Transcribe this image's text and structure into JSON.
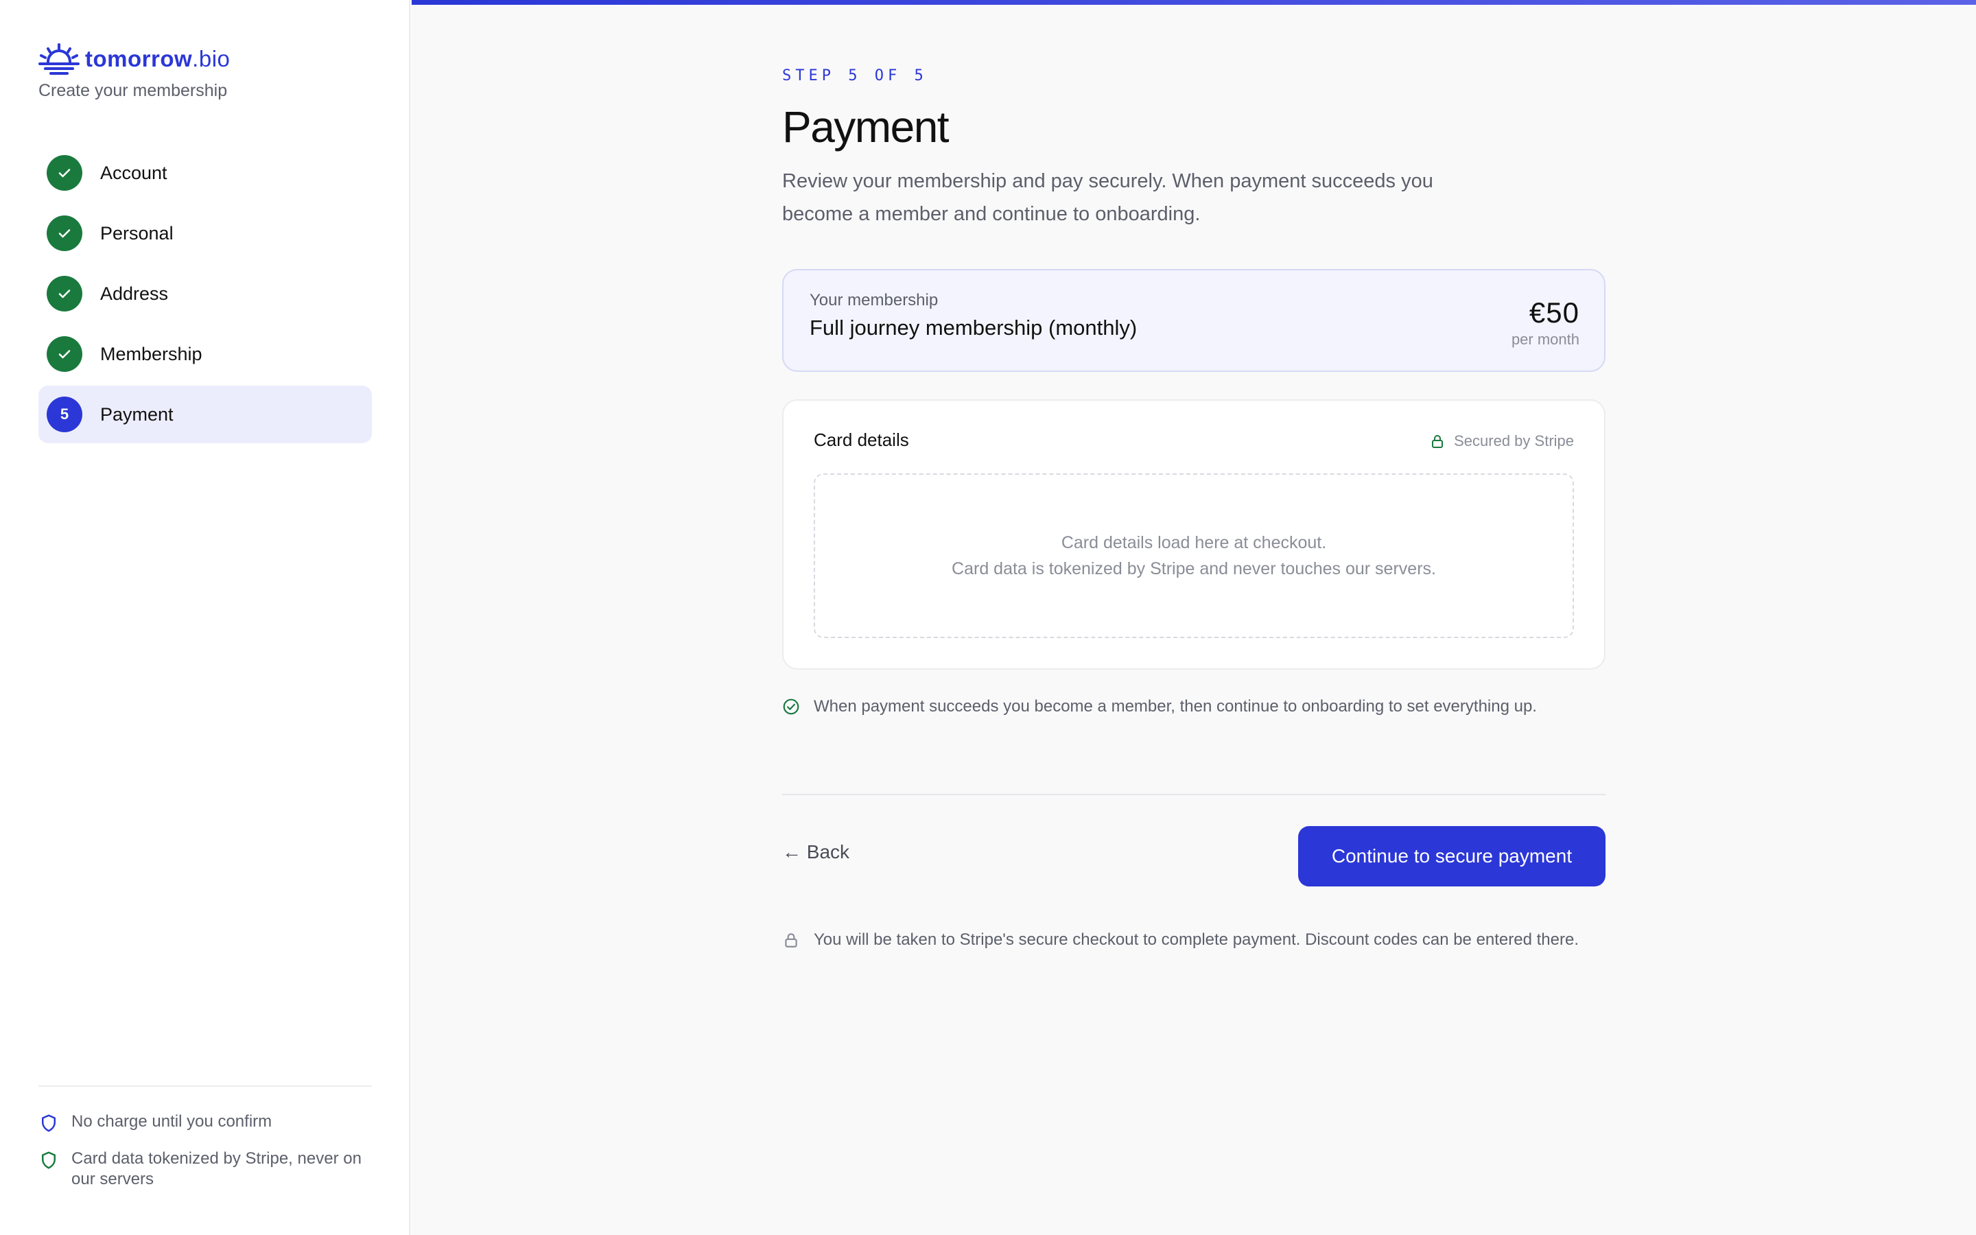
{
  "brand": {
    "name_bold": "tomorrow",
    "name_light": ".bio",
    "subtitle": "Create your membership",
    "color": "#2b37d6"
  },
  "steps": [
    {
      "label": "Account",
      "status": "done",
      "icon": "check-icon"
    },
    {
      "label": "Personal",
      "status": "done",
      "icon": "check-icon"
    },
    {
      "label": "Address",
      "status": "done",
      "icon": "check-icon"
    },
    {
      "label": "Membership",
      "status": "done",
      "icon": "check-icon"
    },
    {
      "label": "Payment",
      "status": "active",
      "number": "5"
    }
  ],
  "trust": [
    {
      "icon": "shield-icon",
      "text": "No charge until you confirm"
    },
    {
      "icon": "shield-icon",
      "text": "Card data tokenized by Stripe, never on our servers"
    }
  ],
  "header": {
    "kicker": "STEP 5 OF 5",
    "title": "Payment",
    "description": "Review your membership and pay securely. When payment succeeds you become a member and continue to onboarding."
  },
  "membership": {
    "label": "Your membership",
    "plan": "Full journey membership (monthly)",
    "price": "€50",
    "period": "per month"
  },
  "card": {
    "title": "Card details",
    "secured": "Secured by Stripe",
    "placeholder_line1": "Card details load here at checkout.",
    "placeholder_line2": "Card data is tokenized by Stripe and never touches our servers."
  },
  "success_note": "When payment succeeds you become a member, then continue to onboarding to set everything up.",
  "actions": {
    "back": "← Back",
    "continue": "Continue to secure payment"
  },
  "checkout_note": "You will be taken to Stripe's secure checkout to complete payment. Discount codes can be entered there.",
  "colors": {
    "accent": "#2b37d6",
    "success": "#1a7a3e",
    "muted_text": "#5c5f6a"
  }
}
